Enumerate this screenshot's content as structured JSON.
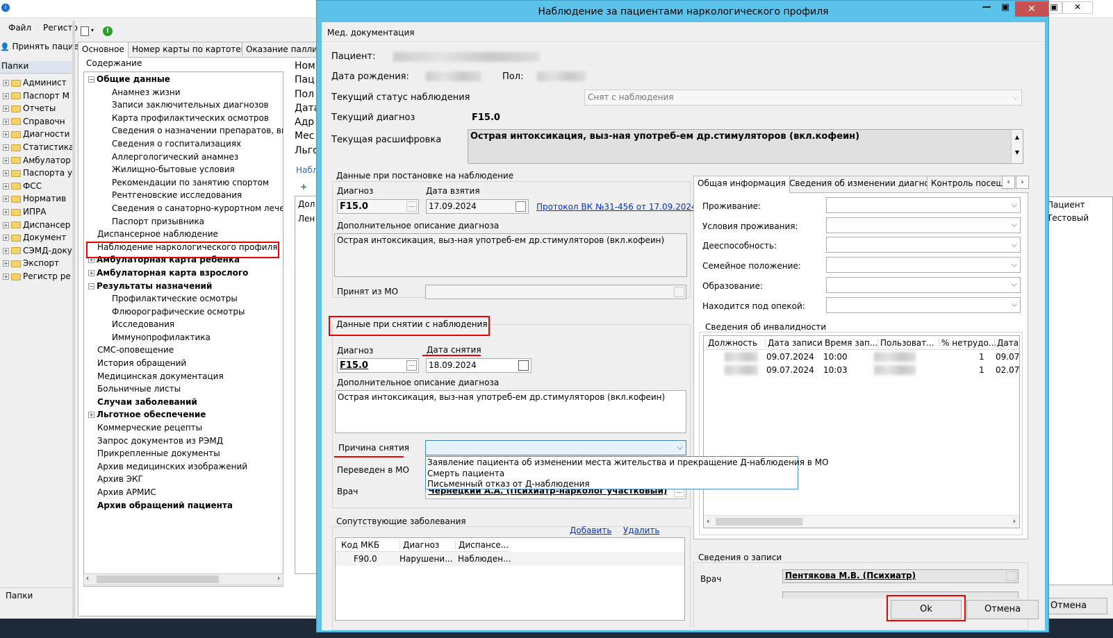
{
  "main_window": {
    "menu": [
      "Файл",
      "Регистр"
    ],
    "accept_button": "Принять пацие",
    "folders_header": "Папки",
    "folders": [
      "Админист",
      "Паспорт М",
      "Отчеты",
      "Справочн",
      "Диагности",
      "Статистика",
      "Амбулатор",
      "Паспорта у",
      "ФСС",
      "Норматив",
      "ИПРА",
      "Диспансер",
      "Документ",
      "СЭМД-доку",
      "Экспорт",
      "Регистр ре"
    ],
    "folders_footer": "Папки",
    "tabs": [
      "Основное",
      "Номер карты по картотеке",
      "Оказание паллиа"
    ],
    "content_header": "Содержание",
    "tree": [
      {
        "label": "Общие данные",
        "bold": true,
        "level": 0,
        "expander": "−"
      },
      {
        "label": "Анамнез жизни",
        "level": 1
      },
      {
        "label": "Записи заключительных диагнозов",
        "level": 1
      },
      {
        "label": "Карта профилактических осмотров",
        "level": 1
      },
      {
        "label": "Сведения о назначении препаратов, выз",
        "level": 1
      },
      {
        "label": "Сведения о госпитализациях",
        "level": 1
      },
      {
        "label": "Аллергологический анамнез",
        "level": 1
      },
      {
        "label": "Жилищно-бытовые условия",
        "level": 1
      },
      {
        "label": "Рекомендации по занятию спортом",
        "level": 1
      },
      {
        "label": "Рентгеновские исследования",
        "level": 1
      },
      {
        "label": "Сведения о санаторно-курортном лечении",
        "level": 1
      },
      {
        "label": "Паспорт призывника",
        "level": 1
      },
      {
        "label": "Диспансерное наблюдение",
        "level": 0
      },
      {
        "label": "Наблюдение наркологического профиля",
        "level": 0
      },
      {
        "label": "Амбулаторная карта ребенка",
        "bold": true,
        "level": 0,
        "expander": "+"
      },
      {
        "label": "Амбулаторная карта взрослого",
        "bold": true,
        "level": 0,
        "expander": "+"
      },
      {
        "label": "Результаты назначений",
        "bold": true,
        "level": 0,
        "expander": "−"
      },
      {
        "label": "Профилактические осмотры",
        "level": 1
      },
      {
        "label": "Флюорографические осмотры",
        "level": 1
      },
      {
        "label": "Исследования",
        "level": 1
      },
      {
        "label": "Иммунопрофилактика",
        "level": 1
      },
      {
        "label": "СМС-оповещение",
        "level": 0
      },
      {
        "label": "История обращений",
        "level": 0
      },
      {
        "label": "Медицинская документация",
        "level": 0
      },
      {
        "label": "Больничные листы",
        "level": 0
      },
      {
        "label": "Случаи заболеваний",
        "bold": true,
        "level": 0
      },
      {
        "label": "Льготное обеспечение",
        "bold": true,
        "level": 0,
        "expander": "+"
      },
      {
        "label": "Коммерческие рецепты",
        "level": 0
      },
      {
        "label": "Запрос документов из РЭМД",
        "level": 0
      },
      {
        "label": "Прикрепленные документы",
        "level": 0
      },
      {
        "label": "Архив медицинских изображений",
        "level": 0
      },
      {
        "label": "Архив ЭКГ",
        "level": 0
      },
      {
        "label": "Архив АРМИС",
        "level": 0
      },
      {
        "label": "Архив обращений пациента",
        "bold": true,
        "level": 0
      }
    ],
    "info_labels": [
      "Ном",
      "Пац",
      "Пол",
      "Дата",
      "Адр",
      "Мес",
      "Льго"
    ],
    "sub_header": "Набл",
    "grid_col": [
      "Дол",
      "Лен"
    ],
    "right_col_header": "Пациент",
    "right_col_value": "Тестовый",
    "cancel_button": "Отмена"
  },
  "dialog": {
    "title": "Наблюдение за пациентами наркологического профиля",
    "menu": "Мед. документация",
    "patient_label": "Пациент:",
    "dob_label": "Дата рождения:",
    "sex_label": "Пол:",
    "status_label": "Текущий статус наблюдения",
    "status_value": "Снят с наблюдения",
    "diagnosis_label": "Текущий диагноз",
    "diagnosis_value": "F15.0",
    "decoding_label": "Текущая расшифровка",
    "decoding_value": "Острая интоксикация, выз-ная употреб-ем др.стимуляторов (вкл.кофеин)",
    "reg": {
      "title": "Данные при постановке на наблюдение",
      "diag_label": "Диагноз",
      "diag_value": "F15.0",
      "date_label": "Дата взятия",
      "date_value": "17.09.2024",
      "protocol_link": "Протокол ВК №31-456 от 17.09.2024",
      "desc_label": "Дополнительное описание диагноза",
      "desc_value": "Острая интоксикация, выз-ная употреб-ем др.стимуляторов (вкл.кофеин)",
      "from_mo_label": "Принят из МО"
    },
    "dereg": {
      "title": "Данные при снятии с наблюдения",
      "diag_label": "Диагноз",
      "diag_value": "F15.0",
      "date_label": "Дата снятия",
      "date_value": "18.09.2024",
      "desc_label": "Дополнительное описание диагноза",
      "desc_value": "Острая интоксикация, выз-ная употреб-ем др.стимуляторов (вкл.кофеин)",
      "reason_label": "Причина снятия",
      "reason_options": [
        "Заявление пациента об изменении места жительства и прекращение Д-наблюдения в МО",
        "Смерть пациента",
        "Письменный отказ от Д-наблюдения"
      ],
      "transfer_label": "Переведен в МО",
      "doctor_label": "Врач",
      "doctor_value": "Чернецкий А.А. (Психиатр-нарколог участковый)"
    },
    "comorbid": {
      "title": "Сопутствующие заболевания",
      "add_link": "Добавить",
      "delete_link": "Удалить",
      "columns": [
        "Код МКБ",
        "Диагноз",
        "Диспансе..."
      ],
      "rows": [
        [
          "F90.0",
          "Нарушени...",
          "Наблюден..."
        ]
      ]
    },
    "tabs": [
      "Общая информация",
      "Сведения об изменении диагноза",
      "Контроль посещ"
    ],
    "general": {
      "fields": [
        "Проживание:",
        "Условия проживания:",
        "Дееспособность:",
        "Семейное положение:",
        "Образование:",
        "Находится под опекой:"
      ],
      "disability_title": "Сведения об инвалидности",
      "disability_columns": [
        "Должность",
        "Дата записи",
        "Время зап...",
        "Пользоват...",
        "% нетрудо...",
        "Дата"
      ],
      "disability_rows": [
        [
          "",
          "09.07.2024",
          "10:00",
          "",
          "1",
          "09.07"
        ],
        [
          "",
          "09.07.2024",
          "10:03",
          "",
          "1",
          "02.07"
        ]
      ]
    },
    "record": {
      "title": "Сведения о записи",
      "doctor_label": "Врач",
      "doctor_value": "Пентякова М.В. (Психиатр)"
    },
    "ok_button": "Ok",
    "cancel_button": "Отмена"
  },
  "colors": {
    "title_bar": "#5bc3ea",
    "close_button": "#c75050",
    "highlight": "#e00000",
    "link": "#0033cc"
  }
}
